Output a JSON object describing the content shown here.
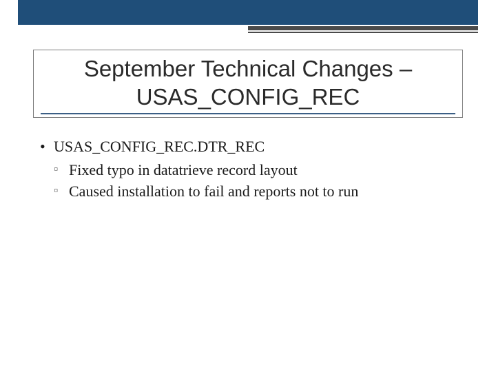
{
  "title": "September Technical Changes – USAS_CONFIG_REC",
  "body": {
    "item1": {
      "label": "USAS_CONFIG_REC.DTR_REC",
      "sub1": "Fixed typo in datatrieve record layout",
      "sub2": "Caused installation to fail and reports not to run"
    }
  }
}
